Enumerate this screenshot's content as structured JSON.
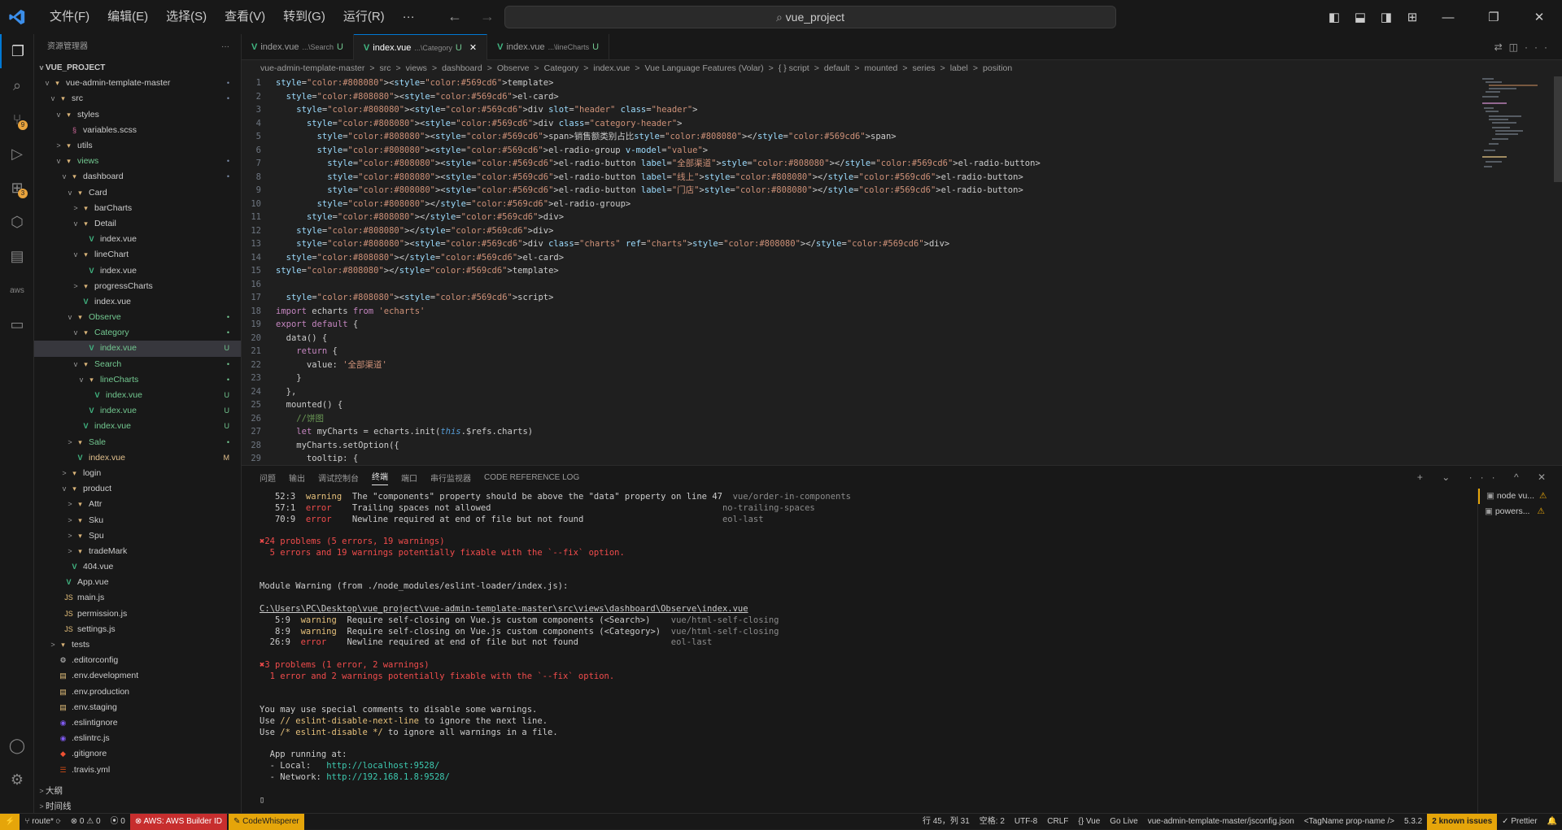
{
  "titlebar": {
    "menu": [
      "文件(F)",
      "编辑(E)",
      "选择(S)",
      "查看(V)",
      "转到(G)",
      "运行(R)",
      "···"
    ],
    "search": "vue_project"
  },
  "sidebar": {
    "title": "资源管理器",
    "more": "···",
    "project": "VUE_PROJECT",
    "items": [
      {
        "label": "vue-admin-template-master",
        "depth": 1,
        "chev": "v",
        "icon": "folder",
        "color": "#cccccc",
        "status": "•",
        "statusColor": "#7a8ba8"
      },
      {
        "label": "src",
        "depth": 2,
        "chev": "v",
        "icon": "folder",
        "color": "#cccccc",
        "status": "•",
        "statusColor": "#7a8ba8"
      },
      {
        "label": "styles",
        "depth": 3,
        "chev": "v",
        "icon": "folder",
        "color": "#cccccc",
        "status": "",
        "statusColor": ""
      },
      {
        "label": "variables.scss",
        "depth": 4,
        "chev": "",
        "icon": "scss",
        "color": "#cccccc",
        "status": "",
        "statusColor": ""
      },
      {
        "label": "utils",
        "depth": 3,
        "chev": ">",
        "icon": "folder",
        "color": "#cccccc",
        "status": "",
        "statusColor": ""
      },
      {
        "label": "views",
        "depth": 3,
        "chev": "v",
        "icon": "folder",
        "color": "#73c991",
        "status": "•",
        "statusColor": "#7a8ba8"
      },
      {
        "label": "dashboard",
        "depth": 4,
        "chev": "v",
        "icon": "folder",
        "color": "#cccccc",
        "status": "•",
        "statusColor": "#7a8ba8"
      },
      {
        "label": "Card",
        "depth": 5,
        "chev": "v",
        "icon": "folder",
        "color": "#cccccc",
        "status": "",
        "statusColor": ""
      },
      {
        "label": "barCharts",
        "depth": 6,
        "chev": ">",
        "icon": "folder",
        "color": "#cccccc",
        "status": "",
        "statusColor": ""
      },
      {
        "label": "Detail",
        "depth": 6,
        "chev": "v",
        "icon": "folder",
        "color": "#cccccc",
        "status": "",
        "statusColor": ""
      },
      {
        "label": "index.vue",
        "depth": 7,
        "chev": "",
        "icon": "vue",
        "color": "#cccccc",
        "status": "",
        "statusColor": ""
      },
      {
        "label": "lineChart",
        "depth": 6,
        "chev": "v",
        "icon": "folder",
        "color": "#cccccc",
        "status": "",
        "statusColor": ""
      },
      {
        "label": "index.vue",
        "depth": 7,
        "chev": "",
        "icon": "vue",
        "color": "#cccccc",
        "status": "",
        "statusColor": ""
      },
      {
        "label": "progressCharts",
        "depth": 6,
        "chev": ">",
        "icon": "folder",
        "color": "#cccccc",
        "status": "",
        "statusColor": ""
      },
      {
        "label": "index.vue",
        "depth": 6,
        "chev": "",
        "icon": "vue",
        "color": "#cccccc",
        "status": "",
        "statusColor": ""
      },
      {
        "label": "Observe",
        "depth": 5,
        "chev": "v",
        "icon": "folder",
        "color": "#73c991",
        "status": "•",
        "statusColor": "#73c991"
      },
      {
        "label": "Category",
        "depth": 6,
        "chev": "v",
        "icon": "folder",
        "color": "#73c991",
        "status": "•",
        "statusColor": "#73c991"
      },
      {
        "label": "index.vue",
        "depth": 7,
        "chev": "",
        "icon": "vue",
        "color": "#73c991",
        "status": "U",
        "statusColor": "#73c991",
        "selected": true
      },
      {
        "label": "Search",
        "depth": 6,
        "chev": "v",
        "icon": "folder",
        "color": "#73c991",
        "status": "•",
        "statusColor": "#73c991"
      },
      {
        "label": "lineCharts",
        "depth": 7,
        "chev": "v",
        "icon": "folder",
        "color": "#73c991",
        "status": "•",
        "statusColor": "#73c991"
      },
      {
        "label": "index.vue",
        "depth": 8,
        "chev": "",
        "icon": "vue",
        "color": "#73c991",
        "status": "U",
        "statusColor": "#73c991"
      },
      {
        "label": "index.vue",
        "depth": 7,
        "chev": "",
        "icon": "vue",
        "color": "#73c991",
        "status": "U",
        "statusColor": "#73c991"
      },
      {
        "label": "index.vue",
        "depth": 6,
        "chev": "",
        "icon": "vue",
        "color": "#73c991",
        "status": "U",
        "statusColor": "#73c991"
      },
      {
        "label": "Sale",
        "depth": 5,
        "chev": ">",
        "icon": "folder",
        "color": "#73c991",
        "status": "•",
        "statusColor": "#73c991"
      },
      {
        "label": "index.vue",
        "depth": 5,
        "chev": "",
        "icon": "vue",
        "color": "#e2c08d",
        "status": "M",
        "statusColor": "#e2c08d"
      },
      {
        "label": "login",
        "depth": 4,
        "chev": ">",
        "icon": "folder",
        "color": "#cccccc",
        "status": "",
        "statusColor": ""
      },
      {
        "label": "product",
        "depth": 4,
        "chev": "v",
        "icon": "folder",
        "color": "#cccccc",
        "status": "",
        "statusColor": ""
      },
      {
        "label": "Attr",
        "depth": 5,
        "chev": ">",
        "icon": "folder",
        "color": "#cccccc",
        "status": "",
        "statusColor": ""
      },
      {
        "label": "Sku",
        "depth": 5,
        "chev": ">",
        "icon": "folder",
        "color": "#cccccc",
        "status": "",
        "statusColor": ""
      },
      {
        "label": "Spu",
        "depth": 5,
        "chev": ">",
        "icon": "folder",
        "color": "#cccccc",
        "status": "",
        "statusColor": ""
      },
      {
        "label": "tradeMark",
        "depth": 5,
        "chev": ">",
        "icon": "folder",
        "color": "#cccccc",
        "status": "",
        "statusColor": ""
      },
      {
        "label": "404.vue",
        "depth": 4,
        "chev": "",
        "icon": "vue",
        "color": "#cccccc",
        "status": "",
        "statusColor": ""
      },
      {
        "label": "App.vue",
        "depth": 3,
        "chev": "",
        "icon": "vue",
        "color": "#cccccc",
        "status": "",
        "statusColor": ""
      },
      {
        "label": "main.js",
        "depth": 3,
        "chev": "",
        "icon": "js",
        "color": "#cccccc",
        "status": "",
        "statusColor": ""
      },
      {
        "label": "permission.js",
        "depth": 3,
        "chev": "",
        "icon": "js",
        "color": "#cccccc",
        "status": "",
        "statusColor": ""
      },
      {
        "label": "settings.js",
        "depth": 3,
        "chev": "",
        "icon": "js",
        "color": "#cccccc",
        "status": "",
        "statusColor": ""
      },
      {
        "label": "tests",
        "depth": 2,
        "chev": ">",
        "icon": "folder",
        "color": "#cccccc",
        "status": "",
        "statusColor": ""
      },
      {
        "label": ".editorconfig",
        "depth": 2,
        "chev": "",
        "icon": "gear",
        "color": "#cccccc",
        "status": "",
        "statusColor": ""
      },
      {
        "label": ".env.development",
        "depth": 2,
        "chev": "",
        "icon": "env",
        "color": "#cccccc",
        "status": "",
        "statusColor": ""
      },
      {
        "label": ".env.production",
        "depth": 2,
        "chev": "",
        "icon": "env",
        "color": "#cccccc",
        "status": "",
        "statusColor": ""
      },
      {
        "label": ".env.staging",
        "depth": 2,
        "chev": "",
        "icon": "env",
        "color": "#cccccc",
        "status": "",
        "statusColor": ""
      },
      {
        "label": ".eslintignore",
        "depth": 2,
        "chev": "",
        "icon": "eslint",
        "color": "#cccccc",
        "status": "",
        "statusColor": ""
      },
      {
        "label": ".eslintrc.js",
        "depth": 2,
        "chev": "",
        "icon": "eslint",
        "color": "#cccccc",
        "status": "",
        "statusColor": ""
      },
      {
        "label": ".gitignore",
        "depth": 2,
        "chev": "",
        "icon": "git",
        "color": "#cccccc",
        "status": "",
        "statusColor": ""
      },
      {
        "label": ".travis.yml",
        "depth": 2,
        "chev": "",
        "icon": "yml",
        "color": "#cccccc",
        "status": "",
        "statusColor": ""
      }
    ],
    "outline": "大纲",
    "timeline": "时间线"
  },
  "tabs": [
    {
      "name": "index.vue",
      "path": "...\\Search",
      "status": "U",
      "active": false
    },
    {
      "name": "index.vue",
      "path": "...\\Category",
      "status": "U",
      "active": true
    },
    {
      "name": "index.vue",
      "path": "...\\lineCharts",
      "status": "U",
      "active": false
    }
  ],
  "breadcrumb": [
    "vue-admin-template-master",
    ">",
    "src",
    ">",
    "views",
    ">",
    "dashboard",
    ">",
    "Observe",
    ">",
    "Category",
    ">",
    "index.vue",
    ">",
    "Vue Language Features (Volar)",
    ">",
    "{ } script",
    ">",
    "default",
    ">",
    "mounted",
    ">",
    "series",
    ">",
    "label",
    ">",
    "position"
  ],
  "code": [
    {
      "n": "1",
      "t": "<template>"
    },
    {
      "n": "2",
      "t": "  <el-card>"
    },
    {
      "n": "3",
      "t": "    <div slot=\"header\" class=\"header\">"
    },
    {
      "n": "4",
      "t": "      <div class=\"category-header\">"
    },
    {
      "n": "5",
      "t": "        <span>销售额类别占比</span>"
    },
    {
      "n": "6",
      "t": "        <el-radio-group v-model=\"value\">"
    },
    {
      "n": "7",
      "t": "          <el-radio-button label=\"全部渠道\"></el-radio-button>"
    },
    {
      "n": "8",
      "t": "          <el-radio-button label=\"线上\"></el-radio-button>"
    },
    {
      "n": "9",
      "t": "          <el-radio-button label=\"门店\"></el-radio-button>"
    },
    {
      "n": "10",
      "t": "        </el-radio-group>"
    },
    {
      "n": "11",
      "t": "      </div>"
    },
    {
      "n": "12",
      "t": "    </div>"
    },
    {
      "n": "13",
      "t": "    <div class=\"charts\" ref=\"charts\"></div>"
    },
    {
      "n": "14",
      "t": "  </el-card>"
    },
    {
      "n": "15",
      "t": "</template>"
    },
    {
      "n": "16",
      "t": ""
    },
    {
      "n": "17",
      "t": "  <script>"
    },
    {
      "n": "18",
      "t": "import echarts from 'echarts'"
    },
    {
      "n": "19",
      "t": "export default {"
    },
    {
      "n": "20",
      "t": "  data() {"
    },
    {
      "n": "21",
      "t": "    return {"
    },
    {
      "n": "22",
      "t": "      value: '全部渠道'"
    },
    {
      "n": "23",
      "t": "    }"
    },
    {
      "n": "24",
      "t": "  },"
    },
    {
      "n": "25",
      "t": "  mounted() {"
    },
    {
      "n": "26",
      "t": "    //饼图"
    },
    {
      "n": "27",
      "t": "    let myCharts = echarts.init(this.$refs.charts)"
    },
    {
      "n": "28",
      "t": "    myCharts.setOption({"
    },
    {
      "n": "29",
      "t": "      tooltip: {"
    }
  ],
  "panel": {
    "tabs": [
      "问题",
      "输出",
      "调试控制台",
      "终端",
      "端口",
      "串行监视器",
      "CODE REFERENCE LOG"
    ],
    "activeTab": "终端",
    "actions": "+ ⌄ ··· ^ ✕",
    "terminals": [
      {
        "name": "node",
        "file": "vu...",
        "warn": "⚠"
      },
      {
        "name": "powers...",
        "file": "",
        "warn": "⚠"
      }
    ],
    "lines": [
      [
        {
          "t": "   52:3  ",
          "c": ""
        },
        {
          "t": "warning",
          "c": "warn"
        },
        {
          "t": "  The \"components\" property should be above the \"data\" property on line 47  ",
          "c": ""
        },
        {
          "t": "vue/order-in-components",
          "c": "dim"
        }
      ],
      [
        {
          "t": "   57:1  ",
          "c": ""
        },
        {
          "t": "error  ",
          "c": "err"
        },
        {
          "t": "  Trailing spaces not allowed                                             ",
          "c": ""
        },
        {
          "t": "no-trailing-spaces",
          "c": "dim"
        }
      ],
      [
        {
          "t": "   70:9  ",
          "c": ""
        },
        {
          "t": "error  ",
          "c": "err"
        },
        {
          "t": "  Newline required at end of file but not found                           ",
          "c": ""
        },
        {
          "t": "eol-last",
          "c": "dim"
        }
      ],
      [
        {
          "t": "",
          "c": ""
        }
      ],
      [
        {
          "t": "✖24 problems (5 errors, 19 warnings)",
          "c": "red"
        }
      ],
      [
        {
          "t": "  5 errors and 19 warnings potentially fixable with the `--fix` option.",
          "c": "red"
        }
      ],
      [
        {
          "t": "",
          "c": ""
        }
      ],
      [
        {
          "t": "",
          "c": ""
        }
      ],
      [
        {
          "t": "Module Warning (from ./node_modules/eslint-loader/index.js):",
          "c": ""
        }
      ],
      [
        {
          "t": "",
          "c": ""
        }
      ],
      [
        {
          "t": "C:\\Users\\PC\\Desktop\\vue_project\\vue-admin-template-master\\src\\views\\dashboard\\Observe\\index.vue",
          "c": "ulink"
        }
      ],
      [
        {
          "t": "   5:9  ",
          "c": ""
        },
        {
          "t": "warning",
          "c": "warn"
        },
        {
          "t": "  Require self-closing on Vue.js custom components (<Search>)    ",
          "c": ""
        },
        {
          "t": "vue/html-self-closing",
          "c": "dim"
        }
      ],
      [
        {
          "t": "   8:9  ",
          "c": ""
        },
        {
          "t": "warning",
          "c": "warn"
        },
        {
          "t": "  Require self-closing on Vue.js custom components (<Category>)  ",
          "c": ""
        },
        {
          "t": "vue/html-self-closing",
          "c": "dim"
        }
      ],
      [
        {
          "t": "  26:9  ",
          "c": ""
        },
        {
          "t": "error  ",
          "c": "err"
        },
        {
          "t": "  Newline required at end of file but not found                  ",
          "c": ""
        },
        {
          "t": "eol-last",
          "c": "dim"
        }
      ],
      [
        {
          "t": "",
          "c": ""
        }
      ],
      [
        {
          "t": "✖3 problems (1 error, 2 warnings)",
          "c": "red"
        }
      ],
      [
        {
          "t": "  1 error and 2 warnings potentially fixable with the `--fix` option.",
          "c": "red"
        }
      ],
      [
        {
          "t": "",
          "c": ""
        }
      ],
      [
        {
          "t": "",
          "c": ""
        }
      ],
      [
        {
          "t": "You may use special comments to disable some warnings.",
          "c": ""
        }
      ],
      [
        {
          "t": "Use ",
          "c": ""
        },
        {
          "t": "// eslint-disable-next-line",
          "c": "warn"
        },
        {
          "t": " to ignore the next line.",
          "c": ""
        }
      ],
      [
        {
          "t": "Use ",
          "c": ""
        },
        {
          "t": "/* eslint-disable */",
          "c": "warn"
        },
        {
          "t": " to ignore all warnings in a file.",
          "c": ""
        }
      ],
      [
        {
          "t": "",
          "c": ""
        }
      ],
      [
        {
          "t": "  App running at:",
          "c": ""
        }
      ],
      [
        {
          "t": "  - Local:   ",
          "c": ""
        },
        {
          "t": "http://localhost:9528/",
          "c": "link"
        }
      ],
      [
        {
          "t": "  - Network: ",
          "c": ""
        },
        {
          "t": "http://192.168.1.8:9528/",
          "c": "link"
        }
      ],
      [
        {
          "t": "",
          "c": ""
        }
      ],
      [
        {
          "t": "▯",
          "c": ""
        }
      ]
    ]
  },
  "statusbar": {
    "remote": "⚡",
    "branch": "route*",
    "sync": "⟳",
    "problems": "⊗ 0 ⚠ 0",
    "ports": "⦿ 0",
    "aws": "AWS: AWS Builder ID",
    "cw": "CodeWhisperer",
    "right": [
      "行 45，列 31",
      "空格: 2",
      "UTF-8",
      "CRLF",
      "{} Vue",
      "Go Live",
      "vue-admin-template-master/jsconfig.json",
      "<TagName prop-name />",
      "5.3.2"
    ],
    "known": "2 known issues",
    "prettier": "✓ Prettier",
    "bell": "🔔"
  }
}
